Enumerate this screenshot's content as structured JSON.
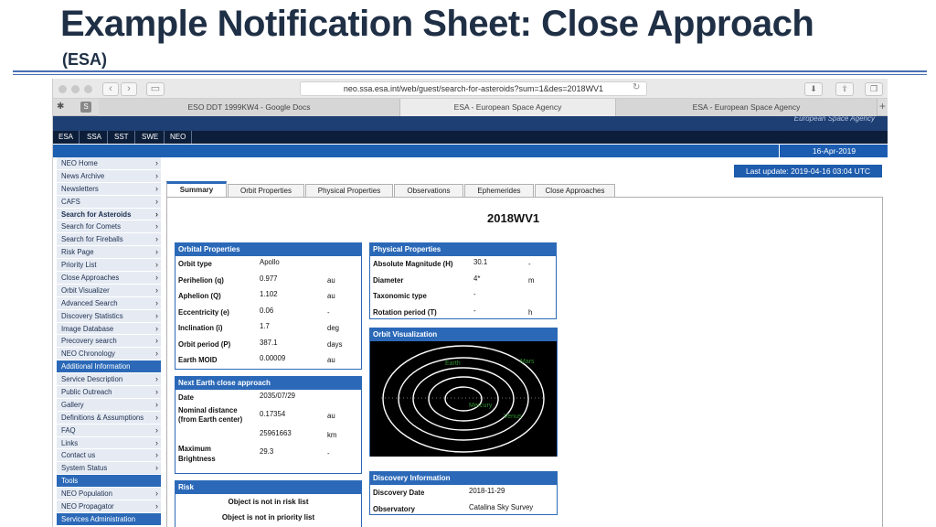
{
  "slide": {
    "title": "Example Notification Sheet:  Close Approach",
    "subtitle": "(ESA)"
  },
  "browser": {
    "url": "neo.ssa.esa.int/web/guest/search-for-asteroids?sum=1&des=2018WV1",
    "tabs": [
      "ESO DDT 1999KW4 - Google Docs",
      "ESA - European Space Agency",
      "ESA - European Space Agency"
    ],
    "new_tab_label": "+"
  },
  "site": {
    "banner_text": "European Space Agency",
    "topnav": [
      "ESA",
      "SSA",
      "SST",
      "SWE",
      "NEO"
    ],
    "date": "16-Apr-2019",
    "last_update": "Last update: 2019-04-16 03:04 UTC"
  },
  "sidebar": [
    {
      "label": "NEO Home",
      "style": "normal"
    },
    {
      "label": "News Archive",
      "style": "normal"
    },
    {
      "label": "Newsletters",
      "style": "normal"
    },
    {
      "label": "CAFS",
      "style": "normal"
    },
    {
      "label": "Search for Asteroids",
      "style": "bold"
    },
    {
      "label": "Search for Comets",
      "style": "normal"
    },
    {
      "label": "Search for Fireballs",
      "style": "normal"
    },
    {
      "label": "Risk Page",
      "style": "normal"
    },
    {
      "label": "Priority List",
      "style": "normal"
    },
    {
      "label": "Close Approaches",
      "style": "normal"
    },
    {
      "label": "Orbit Visualizer",
      "style": "normal"
    },
    {
      "label": "Advanced Search",
      "style": "normal"
    },
    {
      "label": "Discovery Statistics",
      "style": "normal"
    },
    {
      "label": "Image Database",
      "style": "normal"
    },
    {
      "label": "Precovery search",
      "style": "normal"
    },
    {
      "label": "NEO Chronology",
      "style": "normal"
    },
    {
      "label": "Additional Information",
      "style": "hdr"
    },
    {
      "label": "Service Description",
      "style": "normal"
    },
    {
      "label": "Public Outreach",
      "style": "normal"
    },
    {
      "label": "Gallery",
      "style": "normal"
    },
    {
      "label": "Definitions & Assumptions",
      "style": "normal"
    },
    {
      "label": "FAQ",
      "style": "normal"
    },
    {
      "label": "Links",
      "style": "normal"
    },
    {
      "label": "Contact us",
      "style": "normal"
    },
    {
      "label": "System Status",
      "style": "normal"
    },
    {
      "label": "Tools",
      "style": "hdr"
    },
    {
      "label": "NEO Population",
      "style": "normal"
    },
    {
      "label": "NEO Propagator",
      "style": "normal"
    },
    {
      "label": "Services Administration",
      "style": "hdr"
    }
  ],
  "page_tabs": [
    "Summary",
    "Orbit Properties",
    "Physical Properties",
    "Observations",
    "Ephemerides",
    "Close Approaches"
  ],
  "object_name": "2018WV1",
  "orbital_properties": {
    "header": "Orbital Properties",
    "rows": [
      {
        "k": "Orbit type",
        "v": "Apollo",
        "u": ""
      },
      {
        "k": "Perihelion (q)",
        "v": "0.977",
        "u": "au"
      },
      {
        "k": "Aphelion (Q)",
        "v": "1.102",
        "u": "au"
      },
      {
        "k": "Eccentricity (e)",
        "v": "0.06",
        "u": "-"
      },
      {
        "k": "Inclination (i)",
        "v": "1.7",
        "u": "deg"
      },
      {
        "k": "Orbit period (P)",
        "v": "387.1",
        "u": "days"
      },
      {
        "k": "Earth MOID",
        "v": "0.00009",
        "u": "au"
      }
    ]
  },
  "physical_properties": {
    "header": "Physical Properties",
    "rows": [
      {
        "k": "Absolute Magnitude (H)",
        "v": "30.1",
        "u": "-"
      },
      {
        "k": "Diameter",
        "v": "4*",
        "u": "m"
      },
      {
        "k": "Taxonomic type",
        "v": "-",
        "u": ""
      },
      {
        "k": "Rotation period (T)",
        "v": "-",
        "u": "h"
      }
    ]
  },
  "orbit_visualization": {
    "header": "Orbit Visualization",
    "labels": {
      "earth": "Earth",
      "mars": "Mars",
      "mercury": "Mercury",
      "venus": "Venus"
    }
  },
  "next_close_approach": {
    "header": "Next Earth close approach",
    "date_k": "Date",
    "date_v": "2035/07/29",
    "dist_k1": "Nominal distance",
    "dist_k2": "(from Earth center)",
    "dist_v1": "0.17354",
    "dist_u1": "au",
    "dist_v2": "25961663",
    "dist_u2": "km",
    "bright_k1": "Maximum",
    "bright_k2": "Brightness",
    "bright_v": "29.3",
    "bright_u": "-"
  },
  "discovery": {
    "header": "Discovery Information",
    "rows": [
      {
        "k": "Discovery Date",
        "v": "2018-11-29"
      },
      {
        "k": "Observatory",
        "v": "Catalina Sky Survey"
      }
    ]
  },
  "risk": {
    "header": "Risk",
    "line1": "Object is not in risk list",
    "line2": "Object is not in priority list"
  }
}
